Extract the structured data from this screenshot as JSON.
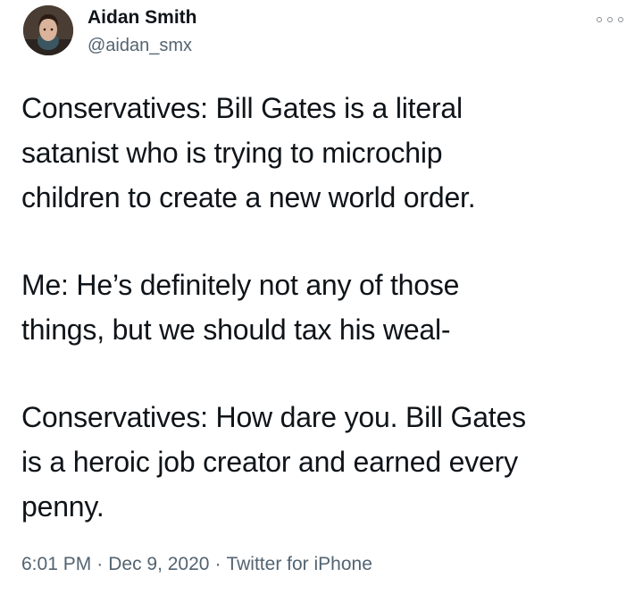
{
  "author": {
    "name": "Aidan Smith",
    "handle": "@aidan_smx"
  },
  "tweet": {
    "paragraphs": [
      [
        "Conservatives: Bill Gates is a literal",
        "satanist who is trying to microchip",
        "children to create a new world order."
      ],
      [
        "Me: He’s definitely not any of those",
        "things, but we should tax his weal-"
      ],
      [
        "Conservatives: How dare you. Bill Gates",
        "is a heroic job creator and earned every",
        "penny."
      ]
    ]
  },
  "meta": {
    "time": "6:01 PM",
    "separator": "·",
    "date": "Dec 9, 2020",
    "source": "Twitter for iPhone"
  },
  "icons": {
    "more": "more-options-icon"
  },
  "colors": {
    "text": "#0f1419",
    "secondary": "#536471",
    "background": "#ffffff"
  }
}
